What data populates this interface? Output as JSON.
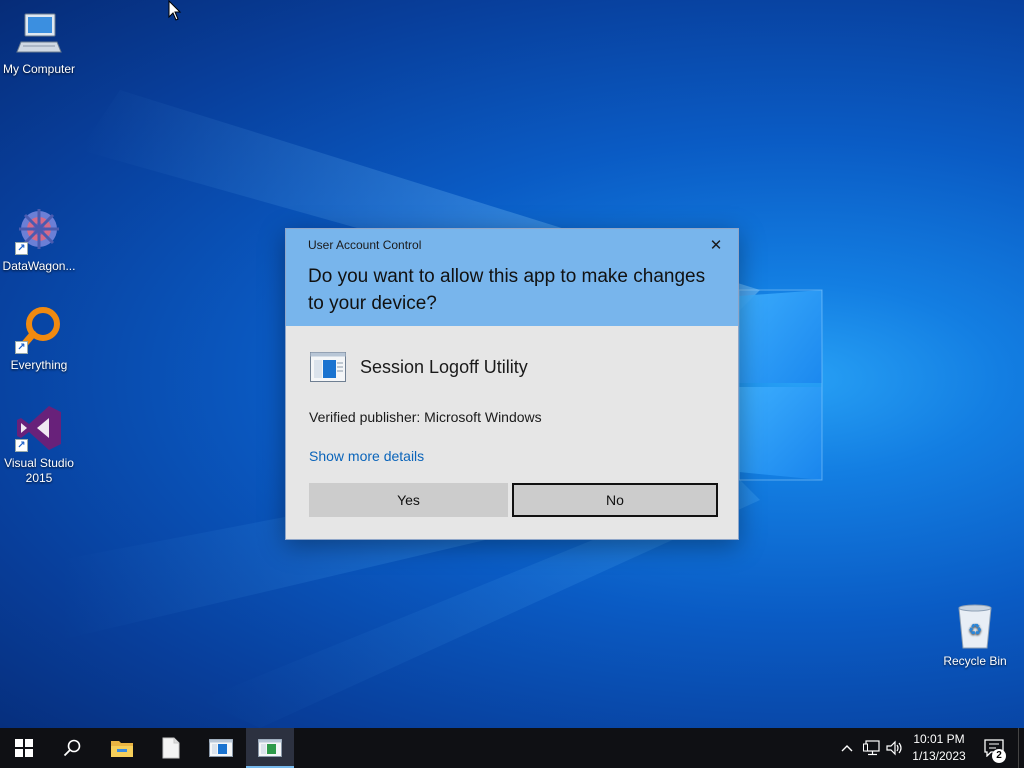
{
  "desktop": {
    "icons": [
      {
        "label": "My Computer",
        "icon": "computer-icon"
      },
      {
        "label": "DataWagon...",
        "icon": "datawagon-icon",
        "shortcut": true
      },
      {
        "label": "Everything",
        "icon": "everything-search-icon",
        "shortcut": true
      },
      {
        "label": "Visual Studio 2015",
        "icon": "visual-studio-icon",
        "shortcut": true
      },
      {
        "label": "Recycle Bin",
        "icon": "recycle-bin-icon"
      }
    ]
  },
  "dialog": {
    "title": "User Account Control",
    "close_glyph": "✕",
    "question": "Do you want to allow this app to make changes to your device?",
    "app_name": "Session Logoff Utility",
    "publisher": "Verified publisher: Microsoft Windows",
    "details_link": "Show more details",
    "yes_label": "Yes",
    "no_label": "No",
    "header_color": "#78b5ec",
    "body_color": "#e6e6e6"
  },
  "taskbar": {
    "items": [
      "start-icon",
      "search-icon",
      "file-explorer-icon",
      "notepad-icon",
      "app-window-icon",
      "uac-app-icon"
    ],
    "active_item": "uac-app-icon",
    "tray": [
      "chevron-up-icon",
      "network-icon",
      "volume-icon"
    ],
    "clock_time": "10:01 PM",
    "clock_date": "1/13/2023",
    "notification_count": "2"
  },
  "colors": {
    "desktop_accent": "#137ee2",
    "taskbar": "#0f1014",
    "link": "#0a64ba"
  }
}
